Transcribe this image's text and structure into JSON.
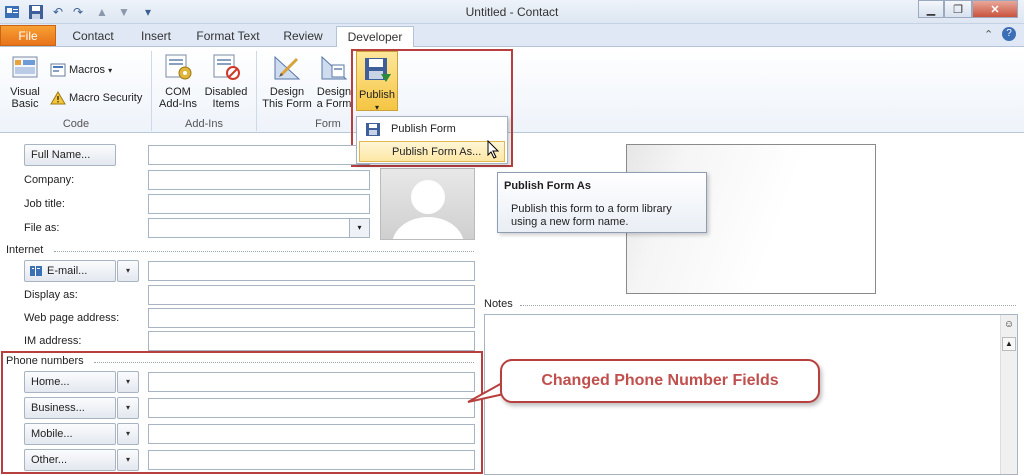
{
  "window": {
    "title": "Untitled  -  Contact",
    "qat_icons": [
      "contact-app-icon",
      "save-icon",
      "undo-icon",
      "redo-icon",
      "up-arrow-icon",
      "down-arrow-icon",
      "customize-qat-icon"
    ],
    "controls": [
      "minimize-icon",
      "restore-icon",
      "close-icon"
    ]
  },
  "tabs": [
    "File",
    "Contact",
    "Insert",
    "Format Text",
    "Review",
    "Developer"
  ],
  "active_tab": "Developer",
  "ribbon": {
    "code": {
      "label": "Code",
      "visual_basic": [
        "Visual",
        "Basic"
      ],
      "macros": "Macros",
      "macro_security": "Macro Security"
    },
    "addins": {
      "label": "Add-Ins",
      "com_addins": [
        "COM",
        "Add-Ins"
      ],
      "disabled_items": [
        "Disabled",
        "Items"
      ]
    },
    "form": {
      "label": "Form",
      "design_this_form": [
        "Design",
        "This Form"
      ],
      "design_a_form": [
        "Design",
        "a Form"
      ],
      "publish": "Publish"
    }
  },
  "publish_menu": {
    "items": [
      "Publish Form",
      "Publish Form As..."
    ],
    "highlighted": "Publish Form As..."
  },
  "tooltip": {
    "title": "Publish Form As",
    "body": [
      "Publish this form to a form library",
      "using a new form name."
    ]
  },
  "form": {
    "full_name_button": "Full Name...",
    "company_label": "Company:",
    "job_title_label": "Job title:",
    "file_as_label": "File as:",
    "internet_section": "Internet",
    "email_button": "E-mail...",
    "display_as_label": "Display as:",
    "web_page_label": "Web page address:",
    "im_label": "IM address:",
    "phone_section": "Phone numbers",
    "phone_buttons": [
      "Home...",
      "Business...",
      "Mobile...",
      "Other..."
    ],
    "notes_label": "Notes"
  },
  "callout": {
    "text": "Changed Phone Number Fields",
    "color": "#c0504d"
  },
  "colors": {
    "highlight_border": "#b7403f",
    "file_tab": "#e8731a",
    "publish_active": "#f5c542"
  }
}
